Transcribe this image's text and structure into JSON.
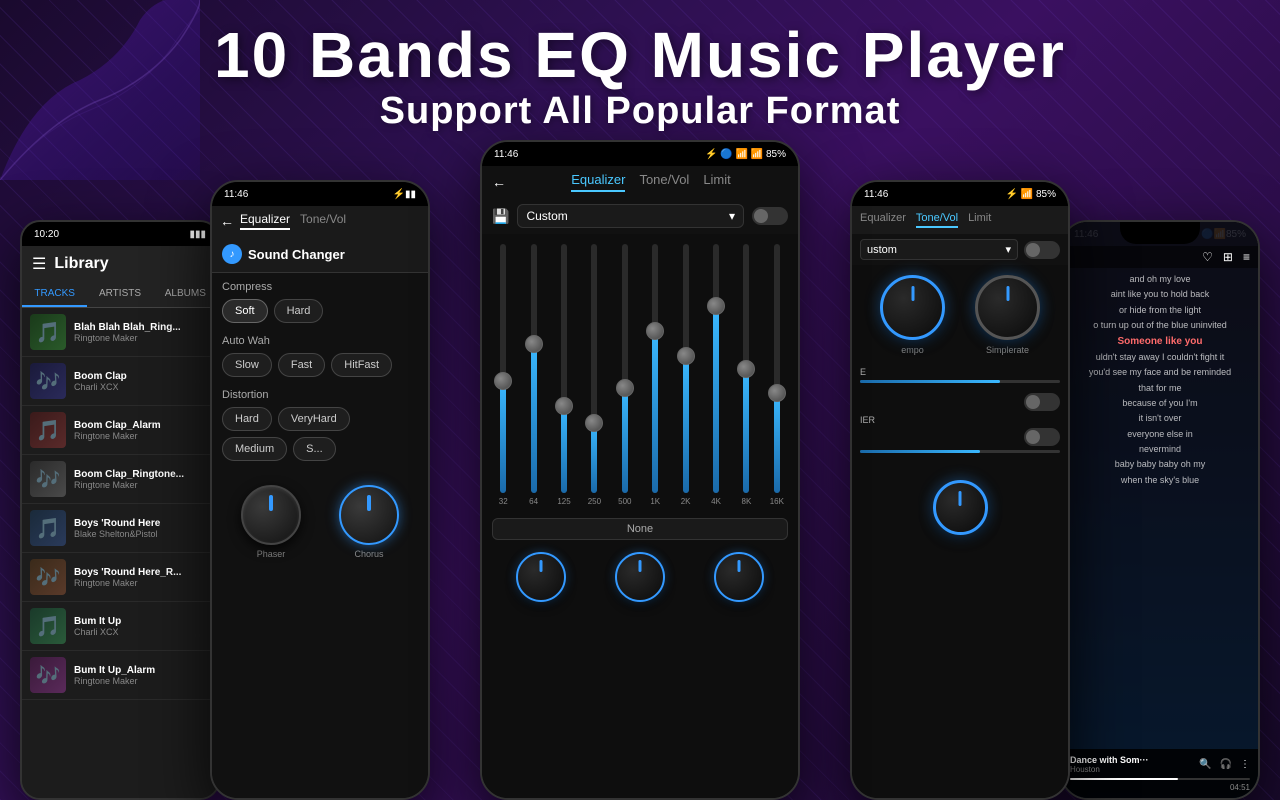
{
  "header": {
    "title": "10 Bands EQ Music Player",
    "subtitle": "Support All Popular  Format"
  },
  "phone1": {
    "status_time": "10:20",
    "title": "Library",
    "tabs": [
      "TRACKS",
      "ARTISTS",
      "ALBUMS"
    ],
    "active_tab": "TRACKS",
    "songs": [
      {
        "title": "Blah Blah Blah_Ringt...",
        "artist": "Ringtone Maker"
      },
      {
        "title": "Boom Clap",
        "artist": "Charli XCX"
      },
      {
        "title": "Boom Clap_Alarm",
        "artist": "Ringtone Maker"
      },
      {
        "title": "Boom Clap_Ringtone...",
        "artist": "Ringtone Maker"
      },
      {
        "title": "Boys 'Round Here",
        "artist": "Blake Shelton&Pistol"
      },
      {
        "title": "Boys 'Round Here_R...",
        "artist": "Ringtone Maker"
      },
      {
        "title": "Bum It Up",
        "artist": "Charli XCX"
      },
      {
        "title": "Bum It Up_Alarm",
        "artist": "Ringtone Maker"
      }
    ]
  },
  "phone2": {
    "status_time": "11:46",
    "tabs": [
      "Equalizer",
      "Tone/Vol"
    ],
    "active_tab": "Equalizer",
    "sound_changer_title": "Sound Changer",
    "compress_label": "Compress",
    "compress_buttons": [
      "Soft",
      "Hard"
    ],
    "auto_wah_label": "Auto Wah",
    "auto_wah_buttons": [
      "Slow",
      "Fast",
      "HitFast"
    ],
    "distortion_label": "Distortion",
    "distortion_buttons": [
      "Hard",
      "VeryHard",
      "Medium",
      "S..."
    ],
    "knobs": [
      "Phaser",
      "Chorus"
    ]
  },
  "phone3": {
    "status_time": "11:46",
    "tabs": [
      "Equalizer",
      "Tone/Vol",
      "Limit"
    ],
    "active_tab": "Equalizer",
    "preset_label": "Custom",
    "bands": [
      {
        "freq": "32",
        "fill_pct": 45,
        "thumb_pct": 45
      },
      {
        "freq": "64",
        "fill_pct": 60,
        "thumb_pct": 60
      },
      {
        "freq": "125",
        "fill_pct": 38,
        "thumb_pct": 38
      },
      {
        "freq": "250",
        "fill_pct": 30,
        "thumb_pct": 30
      },
      {
        "freq": "500",
        "fill_pct": 42,
        "thumb_pct": 42
      },
      {
        "freq": "1K",
        "fill_pct": 65,
        "thumb_pct": 65
      },
      {
        "freq": "2K",
        "fill_pct": 55,
        "thumb_pct": 55
      },
      {
        "freq": "4K",
        "fill_pct": 75,
        "thumb_pct": 75
      },
      {
        "freq": "8K",
        "fill_pct": 50,
        "thumb_pct": 50
      },
      {
        "freq": "16K",
        "fill_pct": 40,
        "thumb_pct": 40
      }
    ],
    "reverb_label": "None",
    "knob_labels": [
      "",
      "",
      ""
    ]
  },
  "phone4": {
    "status_time": "11:46",
    "tabs": [
      "Equalizer",
      "Tone/Vol",
      "Limit"
    ],
    "active_tab": "Tone/Vol",
    "preset_label": "ustom",
    "knobs": [
      "Tempo",
      "Simplerate"
    ],
    "sliders": [
      {
        "label": "E",
        "fill_pct": 70
      },
      {
        "label": "IER",
        "fill_pct": 60
      }
    ]
  },
  "phone5": {
    "lyrics": [
      "and oh my love",
      "aint like you to hold back",
      "or hide from the light",
      "o turn up out of the blue uninvited",
      "Someone like you",
      "uldn't stay away I couldn't fight it",
      "you'd see my face and be reminded",
      "that for me",
      "because of you I'm",
      "it isn't over",
      "everyone else in",
      "nevermind",
      "baby baby baby oh my",
      "when the sky's blue"
    ],
    "highlight_line": "Someone like you",
    "highlight_color": "#ff6b6b",
    "now_playing_title": "Dance with Som···",
    "now_playing_artist": "Houston",
    "time": "04:51"
  }
}
